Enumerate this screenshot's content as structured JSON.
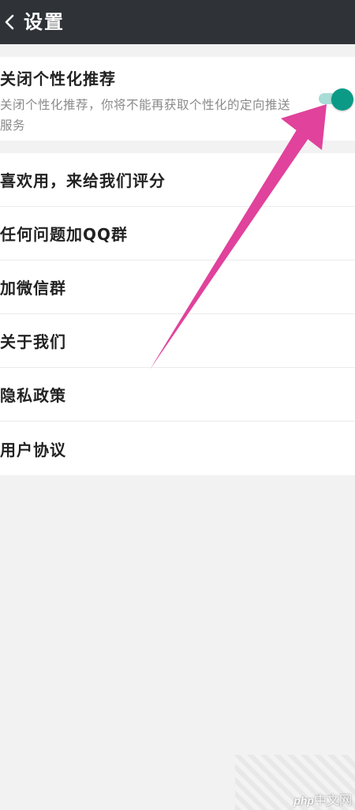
{
  "header": {
    "title": "设置",
    "background_color": "#2f3338",
    "back_icon": "chevron-left-icon"
  },
  "personalization": {
    "title": "关闭个性化推荐",
    "description": "关闭个性化推荐，你将不能再获取个性化的定向推送服务",
    "toggle_on": true,
    "toggle_color": "#0b9a86"
  },
  "settings": {
    "items": [
      {
        "label": "喜欢用，来给我们评分"
      },
      {
        "label": "任何问题加QQ群"
      },
      {
        "label": "加微信群"
      },
      {
        "label": "关于我们"
      },
      {
        "label": "隐私政策"
      },
      {
        "label": "用户协议"
      }
    ]
  },
  "annotation": {
    "color": "#e0429c"
  },
  "watermark": {
    "logo": "php",
    "site": "中文网"
  }
}
